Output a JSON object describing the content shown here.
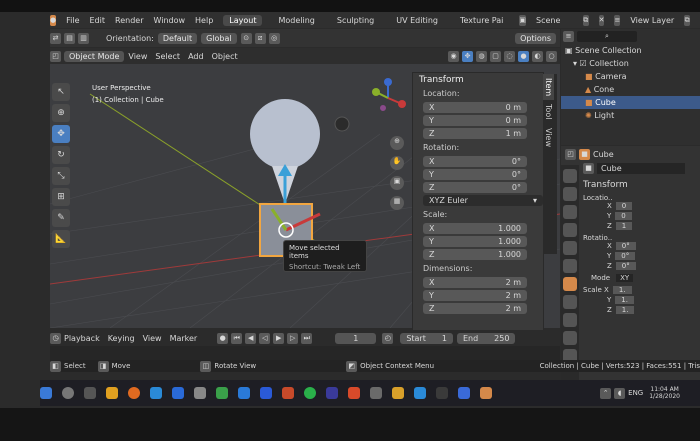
{
  "menubar": {
    "items": [
      "File",
      "Edit",
      "Render",
      "Window",
      "Help"
    ],
    "workspaces": [
      "Layout",
      "Modeling",
      "Sculpting",
      "UV Editing",
      "Texture Pai"
    ],
    "active_workspace": "Layout",
    "scene": "Scene",
    "view_layer": "View Layer"
  },
  "toolbar": {
    "orientation_label": "Orientation:",
    "orientation_value": "Default",
    "transform_value": "Global",
    "options": "Options"
  },
  "header2": {
    "mode": "Object Mode",
    "menus": [
      "View",
      "Select",
      "Add",
      "Object"
    ]
  },
  "viewport": {
    "perspective": "User Perspective",
    "collection": "(1) Collection | Cube"
  },
  "tooltip": {
    "title": "Move selected items",
    "shortcut": "Shortcut: Tweak Left"
  },
  "npanel": {
    "title": "Transform",
    "location_label": "Location:",
    "location": [
      {
        "axis": "X",
        "value": "0 m"
      },
      {
        "axis": "Y",
        "value": "0 m"
      },
      {
        "axis": "Z",
        "value": "1 m"
      }
    ],
    "rotation_label": "Rotation:",
    "rotation": [
      {
        "axis": "X",
        "value": "0°"
      },
      {
        "axis": "Y",
        "value": "0°"
      },
      {
        "axis": "Z",
        "value": "0°"
      }
    ],
    "euler": "XYZ Euler",
    "scale_label": "Scale:",
    "scale": [
      {
        "axis": "X",
        "value": "1.000"
      },
      {
        "axis": "Y",
        "value": "1.000"
      },
      {
        "axis": "Z",
        "value": "1.000"
      }
    ],
    "dimensions_label": "Dimensions:",
    "dimensions": [
      {
        "axis": "X",
        "value": "2 m"
      },
      {
        "axis": "Y",
        "value": "2 m"
      },
      {
        "axis": "Z",
        "value": "2 m"
      }
    ],
    "tabs": [
      "Item",
      "Tool",
      "View"
    ]
  },
  "outliner": {
    "items": [
      "Scene Collection",
      "Collection",
      "Camera",
      "Cone",
      "Cube",
      "Light"
    ],
    "selected": "Cube"
  },
  "props": {
    "object": "Cube",
    "object_name": "Cube",
    "section": "Transform",
    "location_label": "Locatio..",
    "loc": [
      {
        "axis": "X",
        "value": "0"
      },
      {
        "axis": "Y",
        "value": "0"
      },
      {
        "axis": "Z",
        "value": "1"
      }
    ],
    "rotation_label": "Rotatio..",
    "rot": [
      {
        "axis": "X",
        "value": "0°"
      },
      {
        "axis": "Y",
        "value": "0°"
      },
      {
        "axis": "Z",
        "value": "0°"
      }
    ],
    "mode_label": "Mode",
    "mode_value": "XY",
    "scale_label": "Scale X",
    "scale": [
      {
        "axis": "",
        "value": "1."
      },
      {
        "axis": "Y",
        "value": "1."
      },
      {
        "axis": "Z",
        "value": "1."
      }
    ]
  },
  "timeline": {
    "menus": [
      "Playback",
      "Keying",
      "View",
      "Marker"
    ],
    "frame": "1",
    "start_label": "Start",
    "start": "1",
    "end_label": "End",
    "end": "250"
  },
  "status": {
    "select": "Select",
    "move": "Move",
    "rotate": "Rotate View",
    "context": "Object Context Menu",
    "stats": "Collection | Cube | Verts:523 | Faces:551 | Tris"
  },
  "taskbar": {
    "lang": "ENG",
    "time": "11:04 AM",
    "date": "1/28/2020"
  },
  "colors": {
    "accent": "#4a7fc1",
    "selection": "#d5894a",
    "background": "#3c3d40"
  }
}
